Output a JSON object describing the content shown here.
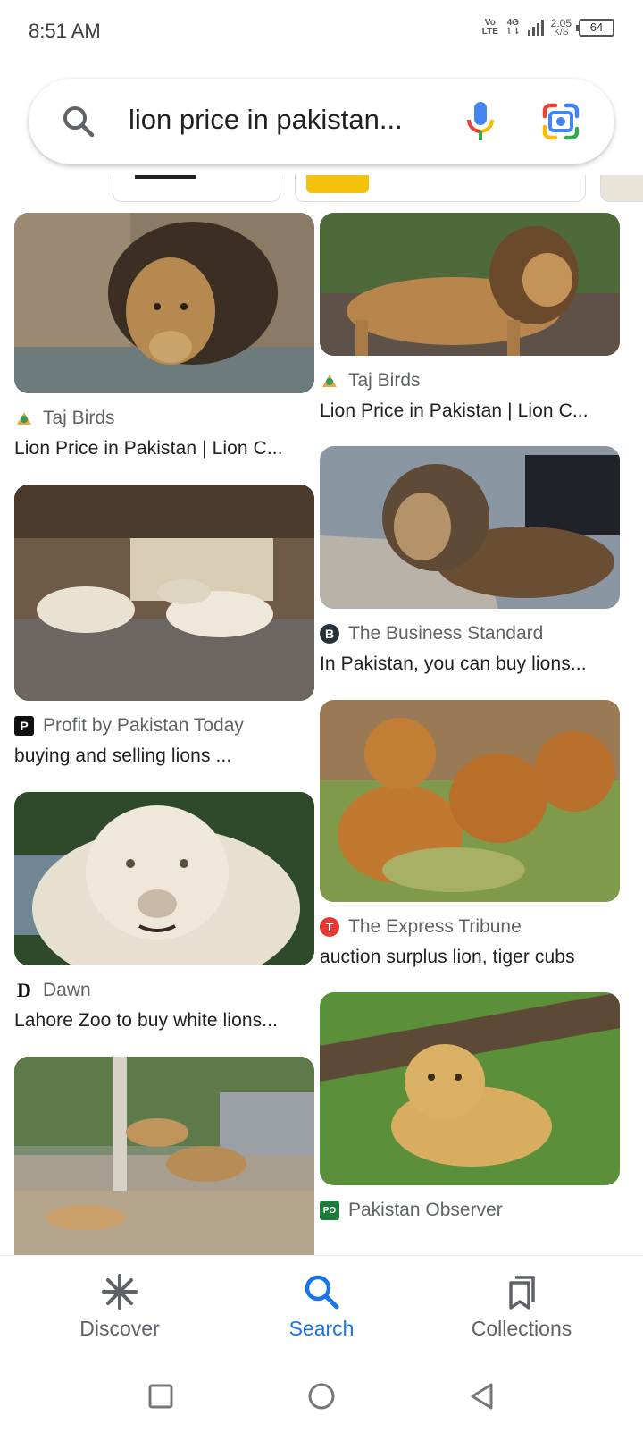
{
  "status_bar": {
    "time": "8:51 AM",
    "volte_top": "Vo",
    "volte_bottom": "LTE",
    "network_top": "4G",
    "network_bottom": "↿⇂",
    "speed_value": "2.05",
    "speed_unit": "K/S",
    "battery": "64"
  },
  "search": {
    "query": "lion price in pakistan..."
  },
  "results": [
    {
      "source": "Taj Birds",
      "title": "Lion Price in Pakistan | Lion C...",
      "logo": "taj-birds-logo"
    },
    {
      "source": "Taj Birds",
      "title": "Lion Price in Pakistan | Lion C...",
      "logo": "taj-birds-logo"
    },
    {
      "source": "Profit by Pakistan Today",
      "title": "buying and selling lions ...",
      "logo": "P"
    },
    {
      "source": "The Business Standard",
      "title": "In Pakistan, you can buy lions...",
      "logo": "B"
    },
    {
      "source": "Dawn",
      "title": "Lahore Zoo to buy white lions...",
      "logo": "D"
    },
    {
      "source": "The Express Tribune",
      "title": "auction surplus lion, tiger cubs",
      "logo": "T"
    },
    {
      "source": "Pakistan Observer",
      "title": "",
      "logo": "PO"
    }
  ],
  "bottom_nav": {
    "discover": "Discover",
    "search": "Search",
    "collections": "Collections"
  },
  "colors": {
    "accent": "#1a73e8",
    "text": "#202124",
    "secondary": "#5f6368"
  }
}
